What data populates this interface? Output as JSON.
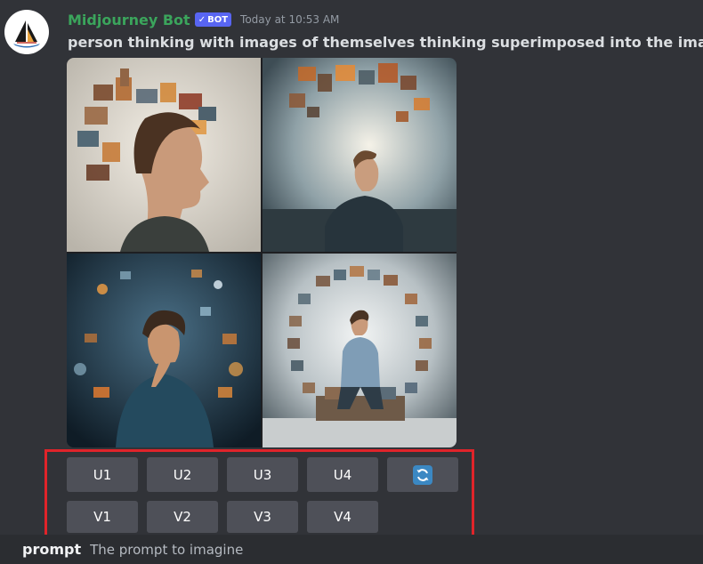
{
  "message": {
    "author": "Midjourney Bot",
    "bot_badge": "BOT",
    "timestamp": "Today at 10:53 AM",
    "text": "person thinking with images of themselves thinking superimposed into the image"
  },
  "image_grid": {
    "tiles": [
      "image-1",
      "image-2",
      "image-3",
      "image-4"
    ]
  },
  "actions": {
    "upscale": [
      "U1",
      "U2",
      "U3",
      "U4"
    ],
    "variation": [
      "V1",
      "V2",
      "V3",
      "V4"
    ],
    "reroll_icon": "refresh-icon"
  },
  "command_option": {
    "name": "prompt",
    "description": "The prompt to imagine"
  },
  "colors": {
    "background": "#313338",
    "username": "#3ba55c",
    "bot_badge": "#5865f2",
    "button": "#4e5058",
    "highlight": "#e0242a"
  }
}
